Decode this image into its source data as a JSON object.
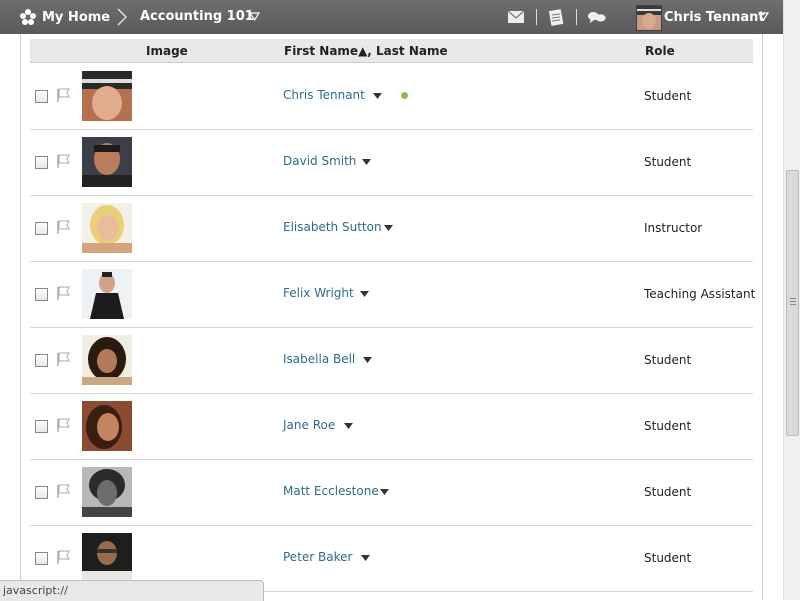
{
  "topbar": {
    "home_label": "My Home",
    "course_label": "Accounting 101",
    "user_label": "Chris Tennant"
  },
  "table": {
    "columns": {
      "image": "Image",
      "name": "First Name▲, Last Name",
      "role": "Role"
    },
    "rows": [
      {
        "name": "Chris Tennant",
        "role": "Student",
        "online": true
      },
      {
        "name": "David Smith",
        "role": "Student",
        "online": false
      },
      {
        "name": "Elisabeth Sutton",
        "role": "Instructor",
        "online": false
      },
      {
        "name": "Felix Wright",
        "role": "Teaching Assistant",
        "online": false
      },
      {
        "name": "Isabella Bell",
        "role": "Student",
        "online": false
      },
      {
        "name": "Jane Roe",
        "role": "Student",
        "online": false
      },
      {
        "name": "Matt Ecclestone",
        "role": "Student",
        "online": false
      },
      {
        "name": "Peter Baker",
        "role": "Student",
        "online": false
      }
    ]
  },
  "statusbar": {
    "text": "javascript://"
  },
  "colors": {
    "topbar": "#5f5f5f",
    "link": "#2a6d88",
    "online": "#8bbf43"
  },
  "icons": [
    "home-icon",
    "mail-icon",
    "notes-icon",
    "chat-icon",
    "flag-icon",
    "caret-down-icon"
  ]
}
